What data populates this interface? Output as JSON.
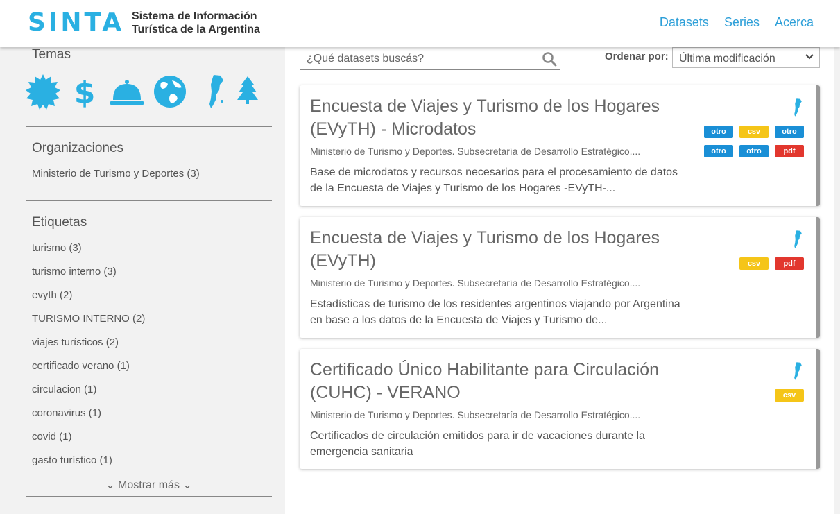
{
  "header": {
    "logo": "SINTA",
    "subtitle_line1": "Sistema de Información",
    "subtitle_line2": "Turística de la Argentina",
    "nav": [
      "Datasets",
      "Series",
      "Acerca"
    ]
  },
  "sidebar": {
    "themes_title": "Temas",
    "theme_icons": [
      "sun-icon",
      "dollar-icon",
      "service-bell-icon",
      "globe-icon",
      "argentina-map-icon",
      "tree-icon"
    ],
    "organizations_title": "Organizaciones",
    "organizations": [
      "Ministerio de Turismo y Deportes (3)"
    ],
    "tags_title": "Etiquetas",
    "tags": [
      "turismo (3)",
      "turismo interno (3)",
      "evyth (2)",
      "TURISMO INTERNO (2)",
      "viajes turísticos (2)",
      "certificado verano (1)",
      "circulacion (1)",
      "coronavirus (1)",
      "covid (1)",
      "gasto turístico (1)"
    ],
    "show_more": "Mostrar más"
  },
  "search": {
    "placeholder": "¿Qué datasets buscás?"
  },
  "sort": {
    "label": "Ordenar por:",
    "selected": "Última modificación"
  },
  "colors": {
    "accent": "#2ab0e2",
    "otro": "#1a8fd6",
    "csv": "#f5c518",
    "pdf": "#e2372e"
  },
  "results": [
    {
      "title": "Encuesta de Viajes y Turismo de los Hogares (EVyTH) - Microdatos",
      "org": "Ministerio de Turismo y Deportes. Subsecretaría de Desarrollo Estratégico....",
      "description": "Base de microdatos y recursos necesarios para el procesamiento de datos de la Encuesta de Viajes y Turismo de los Hogares -EVyTH-...",
      "formats": [
        "otro",
        "csv",
        "otro",
        "otro",
        "otro",
        "pdf"
      ]
    },
    {
      "title": "Encuesta de Viajes y Turismo de los Hogares (EVyTH)",
      "org": "Ministerio de Turismo y Deportes. Subsecretaría de Desarrollo Estratégico....",
      "description": "Estadísticas de turismo de los residentes argentinos viajando por Argentina en base a los datos de la Encuesta de Viajes y Turismo de...",
      "formats": [
        "csv",
        "pdf"
      ]
    },
    {
      "title": "Certificado Único Habilitante para Circulación (CUHC) - VERANO",
      "org": "Ministerio de Turismo y Deportes. Subsecretaría de Desarrollo Estratégico....",
      "description": "Certificados de circulación emitidos para ir de vacaciones durante la emergencia sanitaria",
      "formats": [
        "csv"
      ]
    }
  ]
}
